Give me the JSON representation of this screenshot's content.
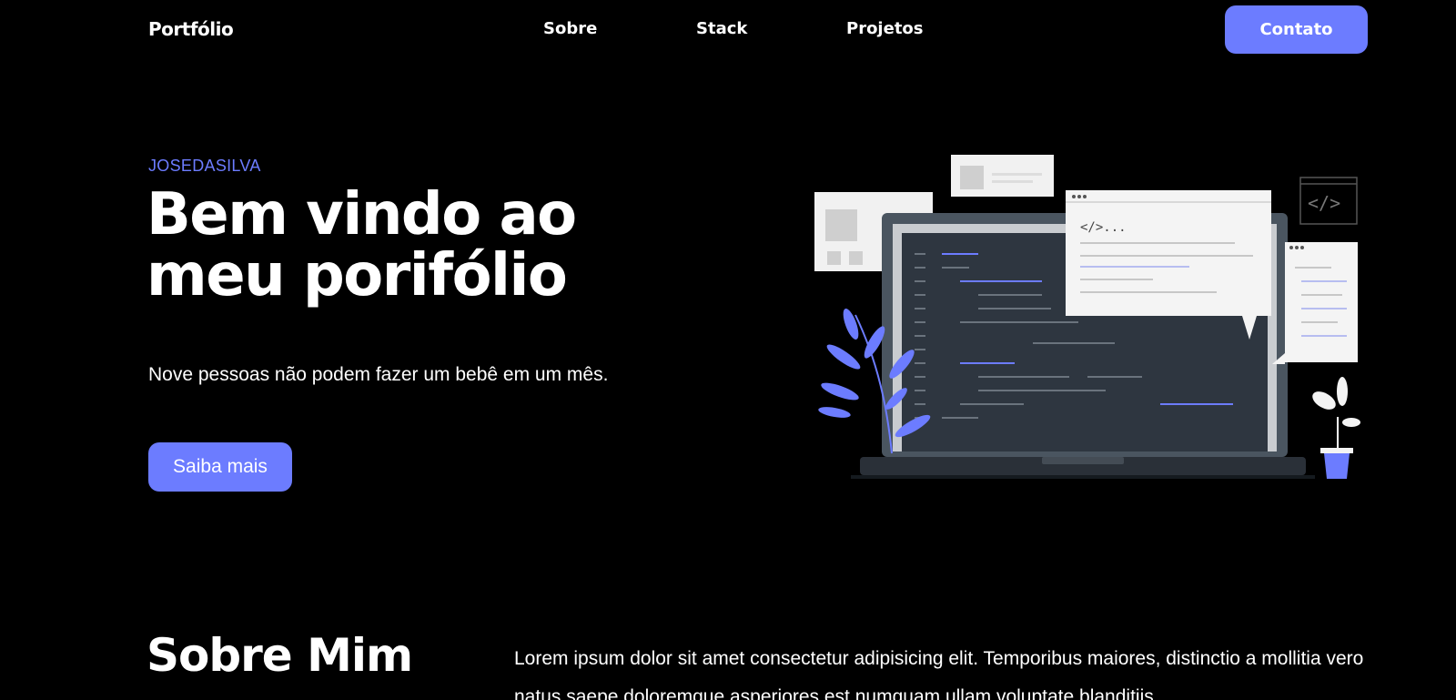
{
  "nav": {
    "brand": "Portfólio",
    "links": [
      "Sobre",
      "Stack",
      "Projetos"
    ],
    "cta": "Contato"
  },
  "hero": {
    "eyebrow": "JOSEDASILVA",
    "title_line1": "Bem vindo ao",
    "title_line2": "meu porifólio",
    "subtitle": "Nove pessoas não podem fazer um bebê em um mês.",
    "cta": "Saiba mais",
    "code_tag": "</>...",
    "code_icon_glyph": "</>"
  },
  "about": {
    "title": "Sobre Mim",
    "text": "Lorem ipsum dolor sit amet consectetur adipisicing elit. Temporibus maiores, distinctio a mollitia vero natus saepe doloremque asperiores est numquam ullam voluptate blanditiis"
  },
  "colors": {
    "background": "#000000",
    "accent": "#6c7cff",
    "text": "#ffffff"
  }
}
